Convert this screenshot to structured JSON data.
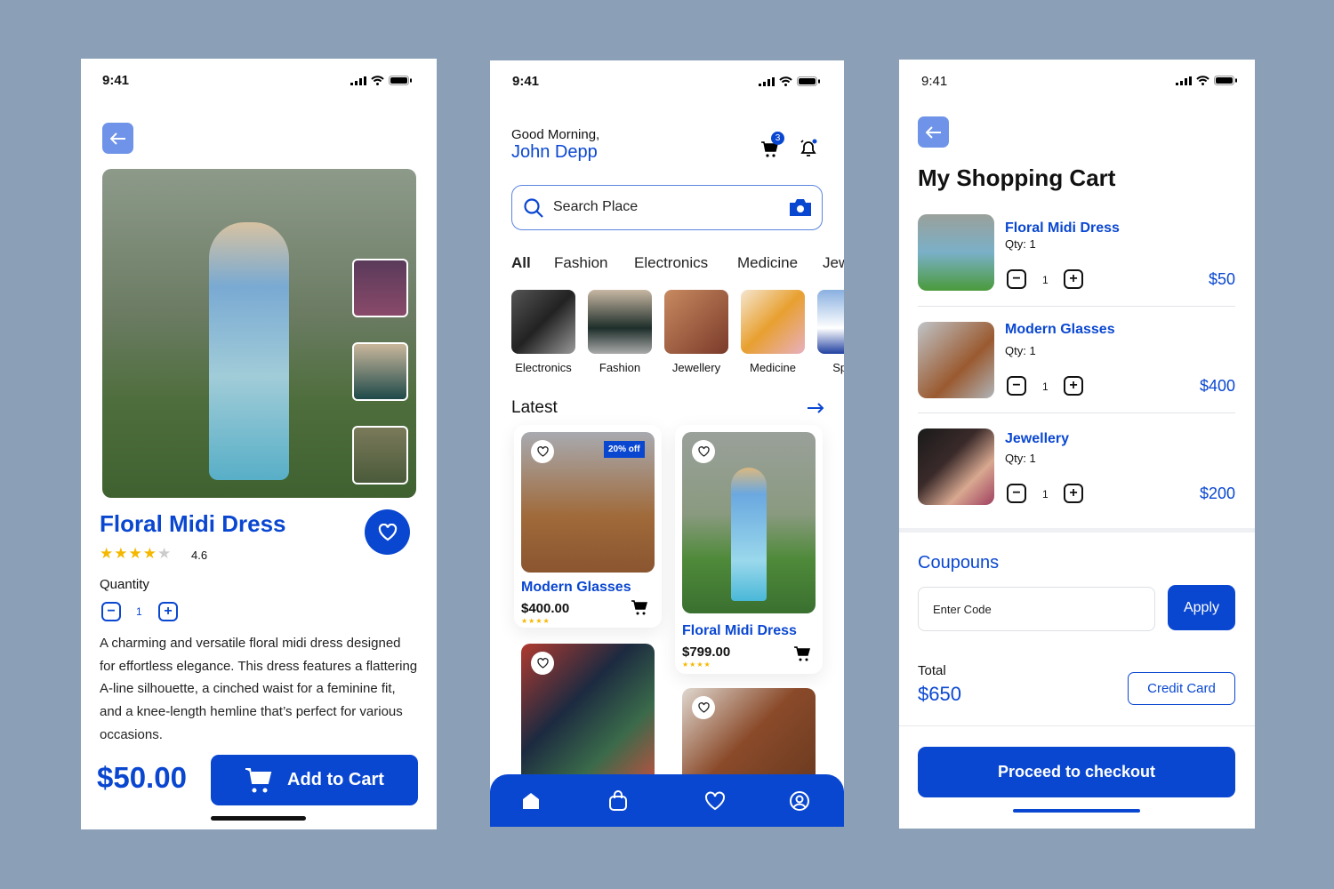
{
  "colors": {
    "background": "#8ba0b7",
    "accent": "#0a47d1",
    "star": "#f5b800"
  },
  "status_time": "9:41",
  "detail": {
    "title": "Floral Midi Dress",
    "rating": "4.6",
    "rating_value": 4.6,
    "quantity_label": "Quantity",
    "quantity": "1",
    "description": "A charming and versatile floral midi dress designed for effortless elegance. This dress features a flattering A-line silhouette, a cinched waist for a feminine fit, and a knee-length hemline that’s perfect for various occasions.",
    "price": "$50.00",
    "add_to_cart": "Add to Cart"
  },
  "home": {
    "greeting": "Good Morning,",
    "user": "John Depp",
    "cart_badge": "3",
    "search_placeholder": "Search Place",
    "tabs": [
      {
        "label": "All",
        "active": true
      },
      {
        "label": "Fashion"
      },
      {
        "label": "Electronics"
      },
      {
        "label": "Medicine"
      },
      {
        "label": "Jewellery"
      }
    ],
    "categories": [
      {
        "label": "Electronics"
      },
      {
        "label": "Fashion"
      },
      {
        "label": "Jewellery"
      },
      {
        "label": "Medicine"
      },
      {
        "label": "Sports"
      }
    ],
    "latest_label": "Latest",
    "products": [
      {
        "name": "Modern Glasses",
        "price": "$400.00",
        "badge": "20% off",
        "stars": "★★★★"
      },
      {
        "name": "Floral Midi Dress",
        "price": "$799.00",
        "stars": "★★★★"
      }
    ],
    "nav": [
      "home-icon",
      "bag-icon",
      "heart-icon",
      "user-icon"
    ]
  },
  "cart": {
    "title": "My Shopping Cart",
    "items": [
      {
        "name": "Floral Midi Dress",
        "qty_label": "Qty: 1",
        "qty": "1",
        "price": "$50"
      },
      {
        "name": "Modern Glasses",
        "qty_label": "Qty: 1",
        "qty": "1",
        "price": "$400"
      },
      {
        "name": "Jewellery",
        "qty_label": "Qty: 1",
        "qty": "1",
        "price": "$200"
      }
    ],
    "coupons_label": "Coupouns",
    "coupon_placeholder": "Enter Code",
    "apply": "Apply",
    "total_label": "Total",
    "total": "$650",
    "payment": "Credit Card",
    "checkout": "Proceed to checkout"
  }
}
